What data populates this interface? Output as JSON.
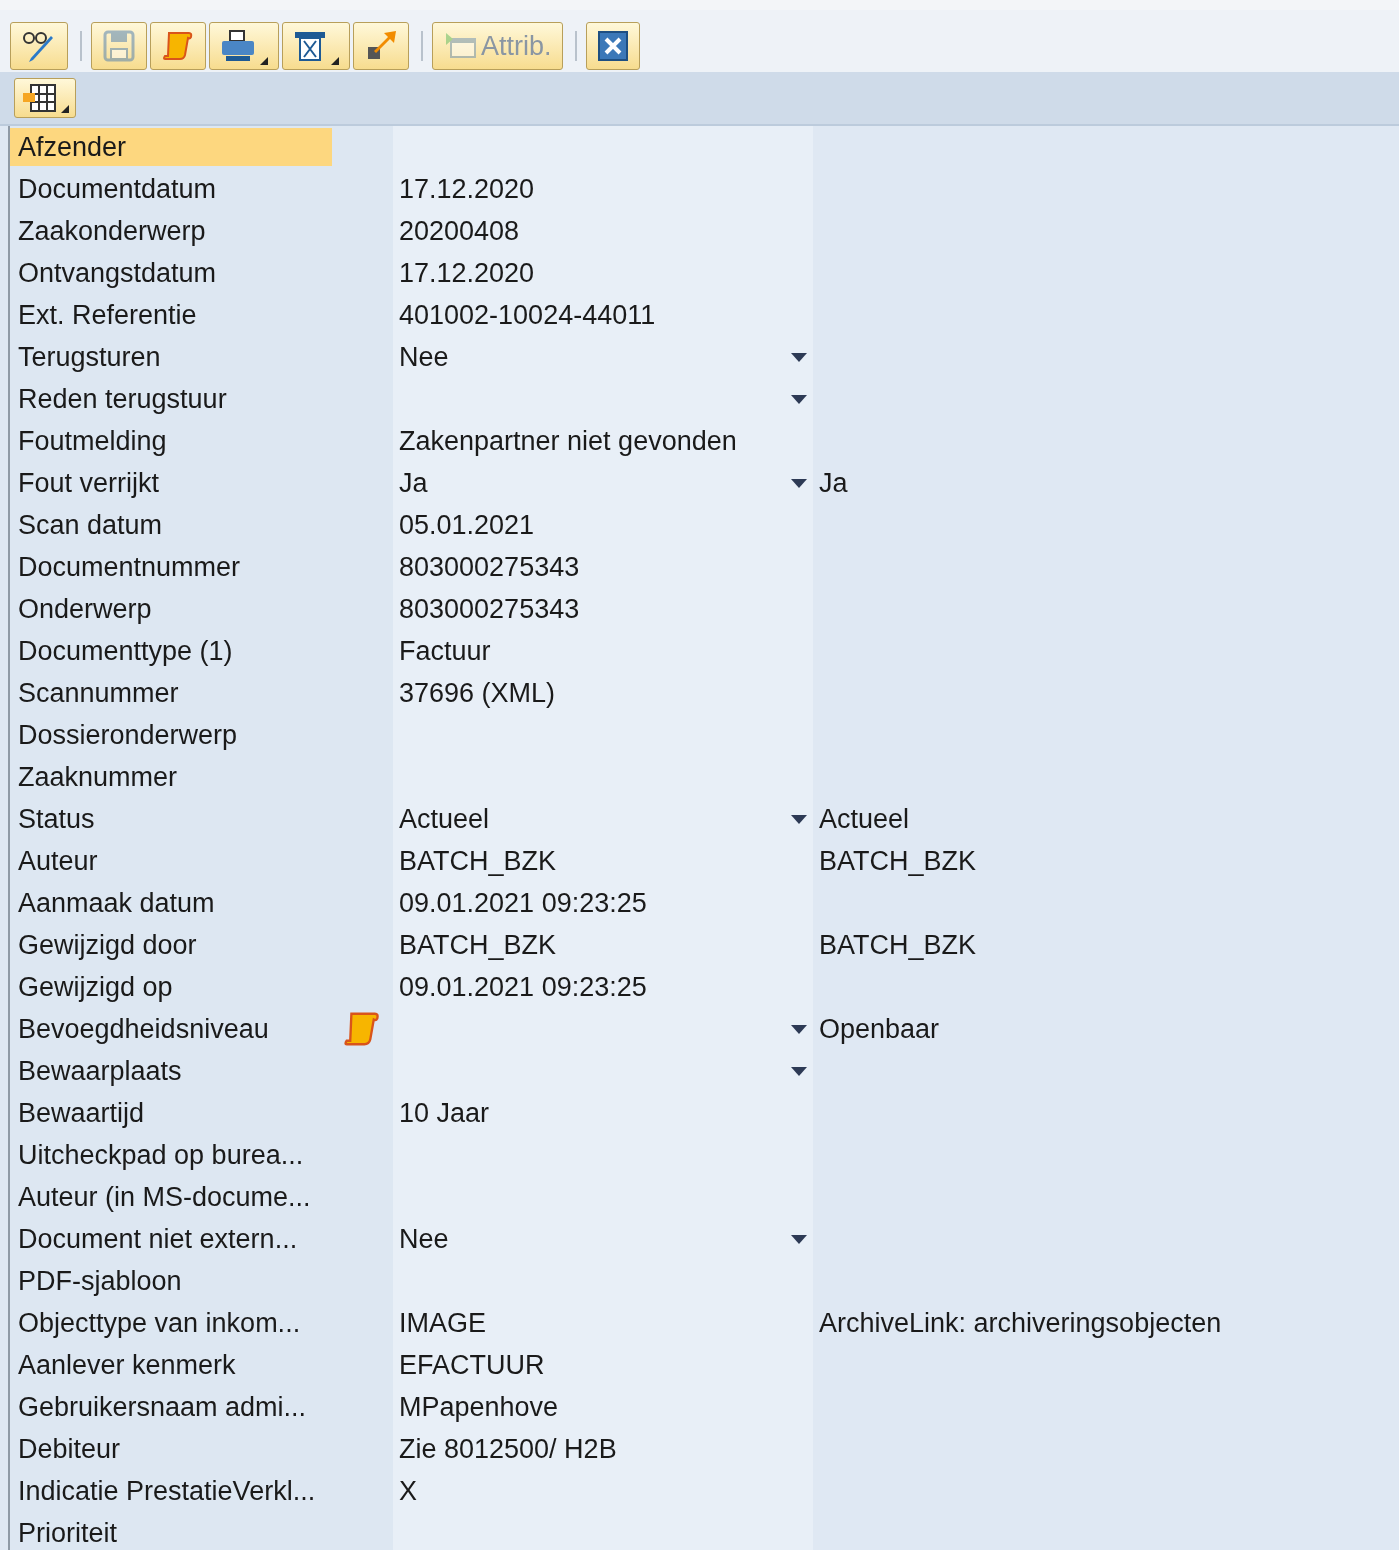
{
  "toolbar": {
    "groups": [
      [
        {
          "kind": "edit",
          "disabled": false,
          "has_menu": false
        }
      ],
      [
        {
          "kind": "save",
          "disabled": true,
          "has_menu": false
        },
        {
          "kind": "scroll",
          "disabled": false,
          "has_menu": false
        },
        {
          "kind": "print",
          "disabled": false,
          "has_menu": true
        },
        {
          "kind": "document",
          "disabled": false,
          "has_menu": true
        },
        {
          "kind": "export",
          "disabled": false,
          "has_menu": false
        }
      ],
      [
        {
          "kind": "attrib",
          "label": "Attrib.",
          "disabled": true,
          "has_menu": false
        }
      ],
      [
        {
          "kind": "close",
          "disabled": false,
          "has_menu": false
        }
      ]
    ]
  },
  "grid_toolbar": {
    "layout_button": {
      "has_menu": true
    }
  },
  "rows": [
    {
      "label": "Afzender",
      "dropdown": false,
      "selected": true
    },
    {
      "label": "Documentdatum",
      "value": "17.12.2020",
      "dropdown": false,
      "selected": false
    },
    {
      "label": "Zaakonderwerp",
      "value": "20200408",
      "dropdown": false,
      "selected": false
    },
    {
      "label": "Ontvangstdatum",
      "value": "17.12.2020",
      "dropdown": false,
      "selected": false
    },
    {
      "label": "Ext. Referentie",
      "value": "401002-10024-44011",
      "dropdown": false,
      "selected": false
    },
    {
      "label": "Terugsturen",
      "value": "Nee",
      "dropdown": true,
      "selected": false
    },
    {
      "label": "Reden terugstuur",
      "dropdown": true,
      "selected": false
    },
    {
      "label": "Foutmelding",
      "value": "Zakenpartner niet gevonden",
      "dropdown": false,
      "selected": false
    },
    {
      "label": "Fout verrijkt",
      "value": "Ja",
      "dropdown": true,
      "extra": "Ja",
      "selected": false
    },
    {
      "label": "Scan datum",
      "value": "05.01.2021",
      "dropdown": false,
      "selected": false
    },
    {
      "label": "Documentnummer",
      "value": "803000275343",
      "dropdown": false,
      "selected": false
    },
    {
      "label": "Onderwerp",
      "value": "803000275343",
      "dropdown": false,
      "selected": false
    },
    {
      "label": "Documenttype (1)",
      "value": "Factuur",
      "dropdown": false,
      "selected": false
    },
    {
      "label": "Scannummer",
      "value": "37696 (XML)",
      "dropdown": false,
      "selected": false
    },
    {
      "label": "Dossieronderwerp",
      "dropdown": false,
      "selected": false
    },
    {
      "label": "Zaaknummer",
      "dropdown": false,
      "selected": false
    },
    {
      "label": "Status",
      "value": "Actueel",
      "dropdown": true,
      "extra": "Actueel",
      "selected": false
    },
    {
      "label": "Auteur",
      "value": "BATCH_BZK",
      "dropdown": false,
      "extra": "BATCH_BZK",
      "selected": false
    },
    {
      "label": "Aanmaak datum",
      "value": "09.01.2021 09:23:25",
      "dropdown": false,
      "selected": false
    },
    {
      "label": "Gewijzigd door",
      "value": "BATCH_BZK",
      "dropdown": false,
      "extra": "BATCH_BZK",
      "selected": false
    },
    {
      "label": "Gewijzigd op",
      "value": "09.01.2021 09:23:25",
      "dropdown": false,
      "selected": false
    },
    {
      "label": "Bevoegdheidsniveau",
      "has_icon": true,
      "dropdown": true,
      "extra": "Openbaar",
      "selected": false
    },
    {
      "label": "Bewaarplaats",
      "dropdown": true,
      "selected": false
    },
    {
      "label": "Bewaartijd",
      "value": "10 Jaar",
      "dropdown": false,
      "selected": false
    },
    {
      "label": "Uitcheckpad op burea...",
      "dropdown": false,
      "selected": false
    },
    {
      "label": "Auteur (in MS-docume...",
      "dropdown": false,
      "selected": false
    },
    {
      "label": "Document niet extern...",
      "value": "Nee",
      "dropdown": true,
      "selected": false
    },
    {
      "label": "PDF-sjabloon",
      "dropdown": false,
      "selected": false
    },
    {
      "label": "Objecttype van inkom...",
      "value": "IMAGE",
      "dropdown": false,
      "extra": "ArchiveLink: archiveringsobjecten",
      "selected": false
    },
    {
      "label": "Aanlever kenmerk",
      "value": "EFACTUUR",
      "dropdown": false,
      "selected": false
    },
    {
      "label": "Gebruikersnaam admi...",
      "value": "MPapenhove",
      "dropdown": false,
      "selected": false
    },
    {
      "label": "Debiteur",
      "value": "Zie 8012500/ H2B",
      "dropdown": false,
      "selected": false
    },
    {
      "label": "Indicatie PrestatieVerkl...",
      "value": "X",
      "dropdown": false,
      "selected": false
    },
    {
      "label": "Prioriteit",
      "dropdown": false,
      "selected": false
    }
  ]
}
